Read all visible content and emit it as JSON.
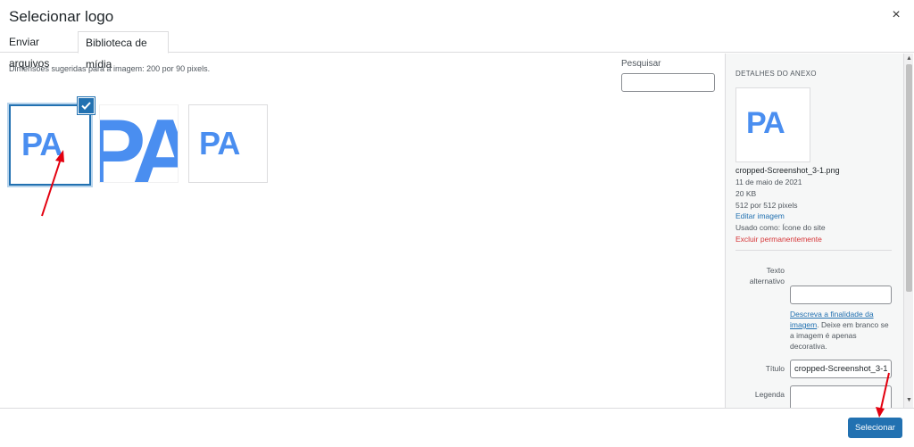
{
  "modal": {
    "title": "Selecionar logo",
    "close_label": "×"
  },
  "tabs": [
    {
      "label": "Enviar arquivos",
      "active": false
    },
    {
      "label": "Biblioteca de mídia",
      "active": true
    }
  ],
  "library": {
    "hint": "Dimensões sugeridas para a imagem: 200 por 90 pixels.",
    "search_label": "Pesquisar",
    "search_value": "",
    "thumbs": [
      {
        "text": "PA",
        "selected": true
      },
      {
        "text": "PA",
        "selected": false
      },
      {
        "text": "PA",
        "selected": false
      }
    ]
  },
  "details": {
    "heading": "DETALHES DO ANEXO",
    "thumb_text": "PA",
    "filename": "cropped-Screenshot_3-1.png",
    "date": "11 de maio de 2021",
    "size": "20 KB",
    "dimensions": "512 por 512 pixels",
    "edit_link": "Editar imagem",
    "used_as": "Usado como: Ícone do site",
    "delete_link": "Excluir permanentemente",
    "alt_label_line1": "Texto",
    "alt_label_line2": "alternativo",
    "alt_value": "",
    "alt_help_link": "Descreva a finalidade da imagem",
    "alt_help_rest": ". Deixe em branco se a imagem é apenas decorativa.",
    "title_label": "Título",
    "title_value": "cropped-Screenshot_3-1",
    "caption_label": "Legenda",
    "caption_value": ""
  },
  "footer": {
    "select_label": "Selecionar"
  },
  "colors": {
    "accent": "#2271b1",
    "logo_blue": "#4a8ef0",
    "annotation_red": "#e3000f",
    "danger": "#d63638"
  }
}
